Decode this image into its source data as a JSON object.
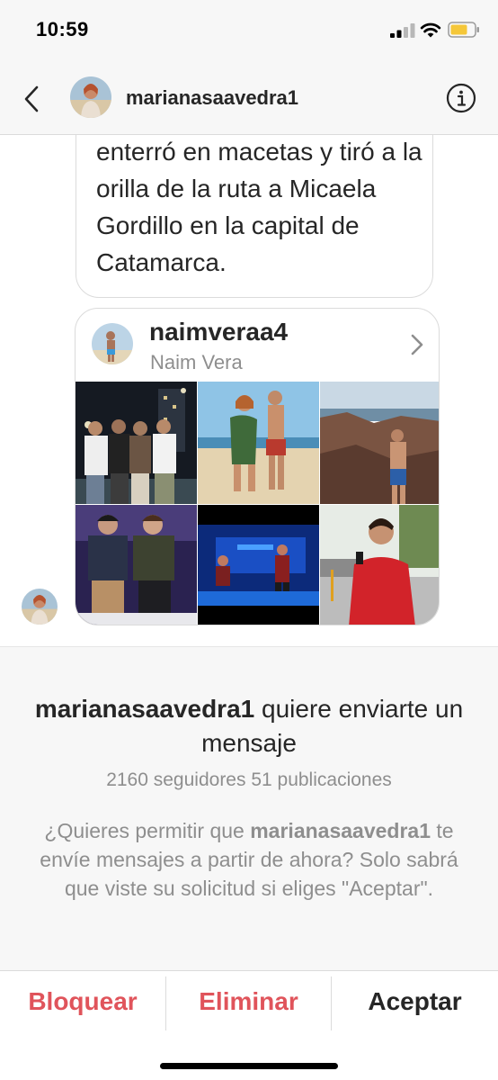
{
  "status_bar": {
    "time": "10:59"
  },
  "header": {
    "username": "marianasaavedra1",
    "back_icon": "chevron-left-icon",
    "info_icon": "info-circle-icon"
  },
  "chat": {
    "message_text": "enterró en macetas y tiró a la orilla de la ruta a Micaela Gordillo en la capital de Catamarca.",
    "shared_profile": {
      "username": "naimveraa4",
      "full_name": "Naim Vera",
      "chevron_icon": "chevron-right-icon"
    }
  },
  "request": {
    "username": "marianasaavedra1",
    "title_suffix": " quiere enviarte un mensaje",
    "stats": "2160 seguidores 51 publicaciones",
    "body_prefix": "¿Quieres permitir que ",
    "body_username": "marianasaavedra1",
    "body_suffix": " te envíe mensajes a partir de ahora? Solo sabrá que viste su solicitud si eliges \"Aceptar\"."
  },
  "actions": {
    "block": "Bloquear",
    "delete": "Eliminar",
    "accept": "Aceptar"
  },
  "colors": {
    "destructive": "#e0545b",
    "text_primary": "#262626",
    "text_secondary": "#8e8e8e",
    "panel_background": "#f7f7f7",
    "battery": "#f5c739"
  }
}
